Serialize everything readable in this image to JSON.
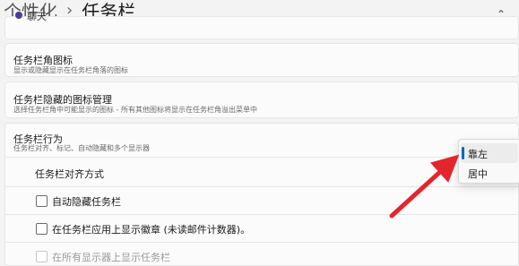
{
  "breadcrumb": {
    "parent": "个性化",
    "separator": "›",
    "current": "任务栏"
  },
  "cutoff_item": {
    "label": "聊天",
    "icon": "chat-icon"
  },
  "corner_icons": {
    "title": "任务栏角图标",
    "description": "显示或隐藏显示在任务栏角落的图标"
  },
  "overflow": {
    "title": "任务栏隐藏的图标管理",
    "description": "选择任务栏角中可能显示的图标 - 所有其他图标将显示在任务栏角溢出菜单中"
  },
  "behaviors": {
    "title": "任务栏行为",
    "description": "任务栏对齐、标记、自动隐藏和多个显示器",
    "alignment_label": "任务栏对齐方式",
    "alignment_options": [
      "靠左",
      "居中"
    ],
    "alignment_selected": "靠左",
    "auto_hide_label": "自动隐藏任务栏",
    "badges_label": "在任务栏应用上显示徽章 (未读邮件计数器)。",
    "multi_display_label": "在所有显示器上显示任务栏"
  },
  "colors": {
    "accent": "#0067c0",
    "annotation_arrow": "#e3262c"
  }
}
